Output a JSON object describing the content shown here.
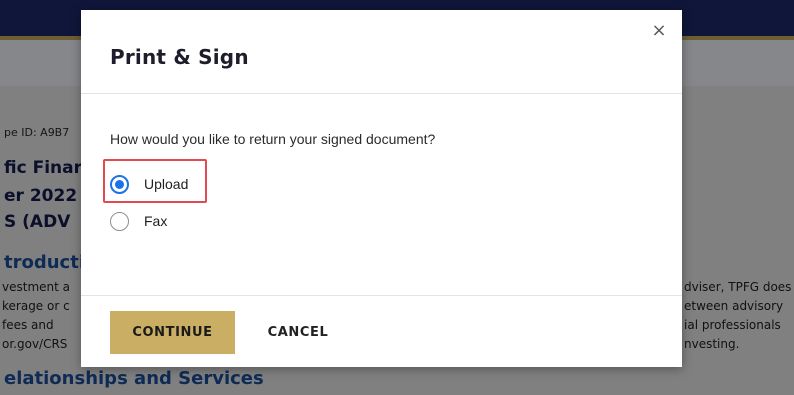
{
  "background": {
    "envelope_id": "pe ID: A9B7",
    "heading_lines": [
      "fic Finar",
      "er 2022",
      "S (ADV"
    ],
    "section_intro": "troducti",
    "left_lines": [
      "vestment a",
      "kerage or c",
      "fees   and",
      "or.gov/CRS"
    ],
    "right_lines": [
      "dviser, TPFG does",
      "etween advisory",
      "ial  professionals",
      "nvesting."
    ],
    "section_relationships": "elationships and Services"
  },
  "modal": {
    "title": "Print & Sign",
    "close_glyph": "×",
    "question": "How would you like to return your signed document?",
    "options": [
      {
        "label": "Upload",
        "selected": true
      },
      {
        "label": "Fax",
        "selected": false
      }
    ],
    "continue_label": "CONTINUE",
    "cancel_label": "CANCEL"
  },
  "colors": {
    "accent_gold": "#c9ae63",
    "radio_blue": "#1a73e8",
    "highlight_red": "#e04a52",
    "header_navy": "#10163a"
  }
}
